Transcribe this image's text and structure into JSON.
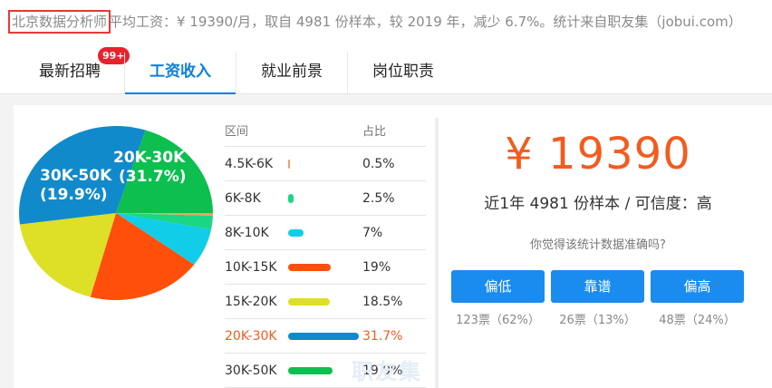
{
  "summary": {
    "job_title": "北京数据分析师",
    "rest": "平均工资：¥ 19390/月，取自 4981 份样本，较 2019 年，减少 6.7%。统计来自职友集（jobui.com）"
  },
  "tabs": [
    {
      "label": "最新招聘",
      "active": false,
      "badge": "99+"
    },
    {
      "label": "工资收入",
      "active": true
    },
    {
      "label": "就业前景",
      "active": false
    },
    {
      "label": "岗位职责",
      "active": false
    }
  ],
  "table": {
    "header_range": "区间",
    "header_pct": "占比",
    "rows": [
      {
        "range": "4.5K-6K",
        "pct": "0.5%",
        "value": 0.5,
        "color": "#f2a061"
      },
      {
        "range": "6K-8K",
        "pct": "2.5%",
        "value": 2.5,
        "color": "#19d783"
      },
      {
        "range": "8K-10K",
        "pct": "7%",
        "value": 7,
        "color": "#12cde8"
      },
      {
        "range": "10K-15K",
        "pct": "19%",
        "value": 19,
        "color": "#ff4f0a"
      },
      {
        "range": "15K-20K",
        "pct": "18.5%",
        "value": 18.5,
        "color": "#dde026"
      },
      {
        "range": "20K-30K",
        "pct": "31.7%",
        "value": 31.7,
        "color": "#118acb",
        "highlight": true
      },
      {
        "range": "30K-50K",
        "pct": "19.9%",
        "value": 19.9,
        "color": "#0cbf4f"
      }
    ]
  },
  "pie_labels": {
    "top": {
      "range": "20K-30K",
      "pct": "(31.7%)"
    },
    "left": {
      "range": "30K-50K",
      "pct": "(19.9%)"
    }
  },
  "watermark": "职友集",
  "salary": {
    "amount": "¥ 19390",
    "sample_text": "近1年 4981 份样本 / 可信度：高",
    "question": "你觉得该统计数据准确吗?"
  },
  "votes": [
    {
      "label": "偏低",
      "count": "123票（62%）"
    },
    {
      "label": "靠谱",
      "count": "26票（13%）"
    },
    {
      "label": "偏高",
      "count": "48票（24%）"
    }
  ],
  "chart_data": {
    "type": "pie",
    "categories": [
      "4.5K-6K",
      "6K-8K",
      "8K-10K",
      "10K-15K",
      "15K-20K",
      "20K-30K",
      "30K-50K"
    ],
    "values": [
      0.5,
      2.5,
      7,
      19,
      18.5,
      31.7,
      19.9
    ],
    "colors": [
      "#f2a061",
      "#19d783",
      "#12cde8",
      "#ff4f0a",
      "#dde026",
      "#118acb",
      "#0cbf4f"
    ]
  }
}
